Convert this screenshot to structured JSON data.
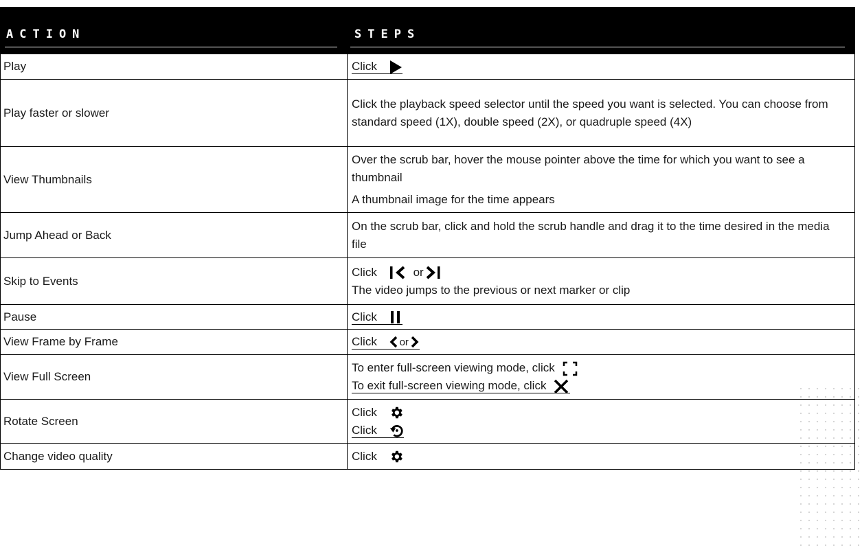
{
  "header": {
    "col_action": "ACTION",
    "col_steps": "STEPS"
  },
  "rows": [
    {
      "action": "Play",
      "steps": [
        "Click"
      ]
    },
    {
      "action": "Play faster or slower",
      "steps": [
        "Click the playback speed selector until the speed you want is selected. You can choose from standard speed (1X), double speed (2X), or quadruple speed (4X)"
      ]
    },
    {
      "action": "View Thumbnails",
      "steps": [
        "Over the scrub bar, hover the mouse pointer above the time for which you want to see a thumbnail",
        "A thumbnail image for the time appears"
      ]
    },
    {
      "action": "Jump Ahead or Back",
      "steps": [
        "On the scrub bar, click and hold the scrub handle and drag it to the time desired in the media file"
      ]
    },
    {
      "action": "Skip to Events",
      "steps": [
        "Click",
        "The video jumps to the previous or next marker or clip"
      ],
      "or_label": "or"
    },
    {
      "action": "Pause",
      "steps": [
        "Click"
      ]
    },
    {
      "action": "View Frame by Frame",
      "steps": [
        "Click"
      ],
      "or_label": "or"
    },
    {
      "action": "View Full Screen",
      "steps": [
        "To enter full-screen viewing mode, click",
        "To exit full-screen viewing mode, click"
      ]
    },
    {
      "action": "Rotate Screen",
      "steps": [
        "Click",
        "Click"
      ]
    },
    {
      "action": "Change video quality",
      "steps": [
        "Click"
      ]
    }
  ],
  "icons": {
    "play": "play-icon",
    "skip_prev": "skip-previous-icon",
    "skip_next": "skip-next-icon",
    "pause": "pause-icon",
    "frame_prev": "frame-previous-icon",
    "frame_next": "frame-next-icon",
    "fullscreen": "fullscreen-icon",
    "exit_fullscreen": "close-icon",
    "settings": "gear-icon",
    "rotate": "rotate-icon"
  }
}
